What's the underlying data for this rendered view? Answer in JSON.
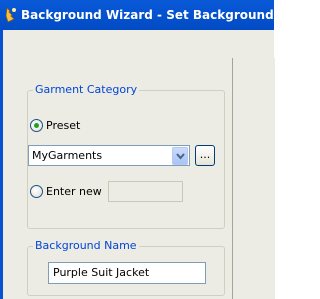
{
  "window": {
    "title": "Background Wizard - Set Background Name",
    "icon": "wizard-app-icon"
  },
  "garment_category": {
    "caption": "Garment Category",
    "preset_label": "Preset",
    "preset_selected": true,
    "preset_value": "MyGarments",
    "browse_label": "...",
    "enter_new_label": "Enter new",
    "enter_new_selected": false,
    "enter_new_value": ""
  },
  "background_name": {
    "caption": "Background Name",
    "value": "Purple Suit Jacket"
  },
  "colors": {
    "titlebar": "#0553d0",
    "dialog_bg": "#ecebe4",
    "groupbox_caption": "#0046d5",
    "radio_dot": "#21a121"
  }
}
